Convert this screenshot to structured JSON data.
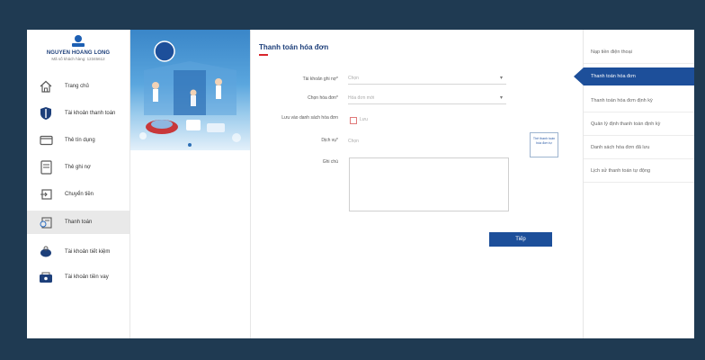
{
  "brand": {
    "name": "NGUYEN HOANG LONG",
    "subtitle": "Mã số khách hàng: 12345612"
  },
  "sidebar": {
    "items": [
      {
        "label": "Trang chủ",
        "icon": "home-icon"
      },
      {
        "label": "Tài khoản thanh toán",
        "icon": "shield-icon"
      },
      {
        "label": "Thẻ tín dụng",
        "icon": "card-icon"
      },
      {
        "label": "Thẻ ghi nợ",
        "icon": "debit-card-icon"
      },
      {
        "label": "Chuyển tiền",
        "icon": "transfer-icon"
      },
      {
        "label": "Thanh toán",
        "icon": "payment-icon",
        "active": true
      },
      {
        "label": "Tài khoản tiết kiệm",
        "icon": "piggy-bank-icon"
      },
      {
        "label": "Tài khoản tiền vay",
        "icon": "loan-icon"
      }
    ]
  },
  "form": {
    "title": "Thanh toán hóa đơn",
    "source_account_label": "Tài khoản ghi nợ*",
    "source_account_placeholder": "Chọn",
    "bill_label": "Chọn hóa đơn*",
    "bill_placeholder": "Hóa đơn mới",
    "save_list_label": "Lưu vào danh sách hóa đơn",
    "save_list_option": "Lưu",
    "service_label": "Dịch vụ*",
    "service_placeholder": "Chọn",
    "note_label": "Ghi chú",
    "mini_card_text": "Thẻ thanh toán hóa đơn tự",
    "next_button": "Tiếp"
  },
  "right_menu": {
    "items": [
      {
        "label": "Nạp tiền điện thoại"
      },
      {
        "label": "Thanh toán hóa đơn",
        "active": true
      },
      {
        "label": "Thanh toán hóa đơn định kỳ"
      },
      {
        "label": "Quản lý định thanh toán định kỳ"
      },
      {
        "label": "Danh sách hóa đơn đã lưu"
      },
      {
        "label": "Lịch sử thanh toán tự động"
      }
    ]
  },
  "colors": {
    "frame": "#1f3a52",
    "primary": "#1d4f9a",
    "accent_red": "#d9262d",
    "active_sidebar": "#e9e9e9"
  }
}
